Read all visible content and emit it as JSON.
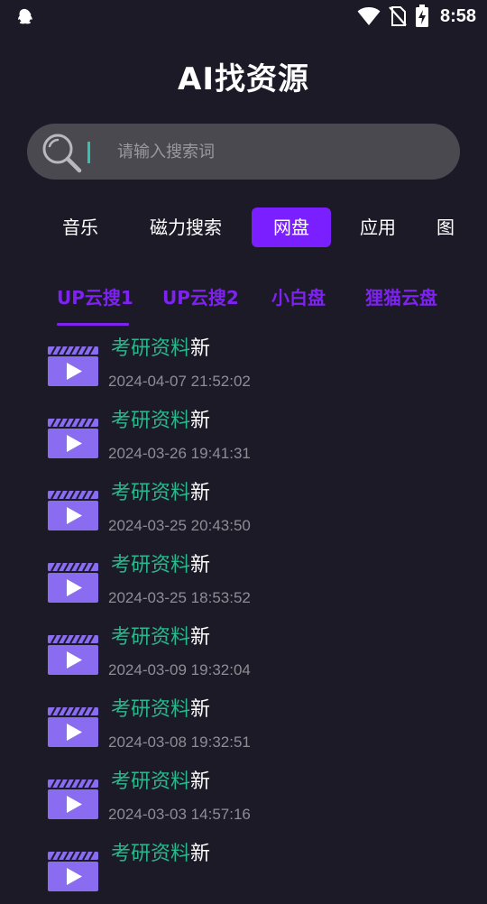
{
  "status_bar": {
    "time": "8:58",
    "icons": [
      "qq-icon",
      "wifi-icon",
      "no-sim-icon",
      "battery-charging-icon"
    ]
  },
  "app": {
    "title": "AI找资源"
  },
  "search": {
    "placeholder": "请输入搜索词",
    "value": "",
    "icon": "search-icon"
  },
  "category_tabs": [
    {
      "label": "音乐",
      "active": false
    },
    {
      "label": "磁力搜索",
      "active": false
    },
    {
      "label": "网盘",
      "active": true
    },
    {
      "label": "应用",
      "active": false
    },
    {
      "label": "图",
      "active": false
    }
  ],
  "sub_tabs": [
    {
      "label": "UP云搜1",
      "active": true
    },
    {
      "label": "UP云搜2",
      "active": false
    },
    {
      "label": "小白盘",
      "active": false
    },
    {
      "label": "狸猫云盘",
      "active": false
    }
  ],
  "results": [
    {
      "keyword": "考研资料",
      "suffix": "新",
      "date": "2024-04-07 21:52:02"
    },
    {
      "keyword": "考研资料",
      "suffix": "新",
      "date": "2024-03-26 19:41:31"
    },
    {
      "keyword": "考研资料",
      "suffix": "新",
      "date": "2024-03-25 20:43:50"
    },
    {
      "keyword": "考研资料",
      "suffix": "新",
      "date": "2024-03-25 18:53:52"
    },
    {
      "keyword": "考研资料",
      "suffix": "新",
      "date": "2024-03-09 19:32:04"
    },
    {
      "keyword": "考研资料",
      "suffix": "新",
      "date": "2024-03-08 19:32:51"
    },
    {
      "keyword": "考研资料",
      "suffix": "新",
      "date": "2024-03-03 14:57:16"
    },
    {
      "keyword": "考研资料",
      "suffix": "新",
      "date": ""
    }
  ],
  "colors": {
    "background": "#1b1a26",
    "accent": "#7a1fff",
    "keyword": "#26b98d",
    "video_icon": "#8a6cf0"
  }
}
